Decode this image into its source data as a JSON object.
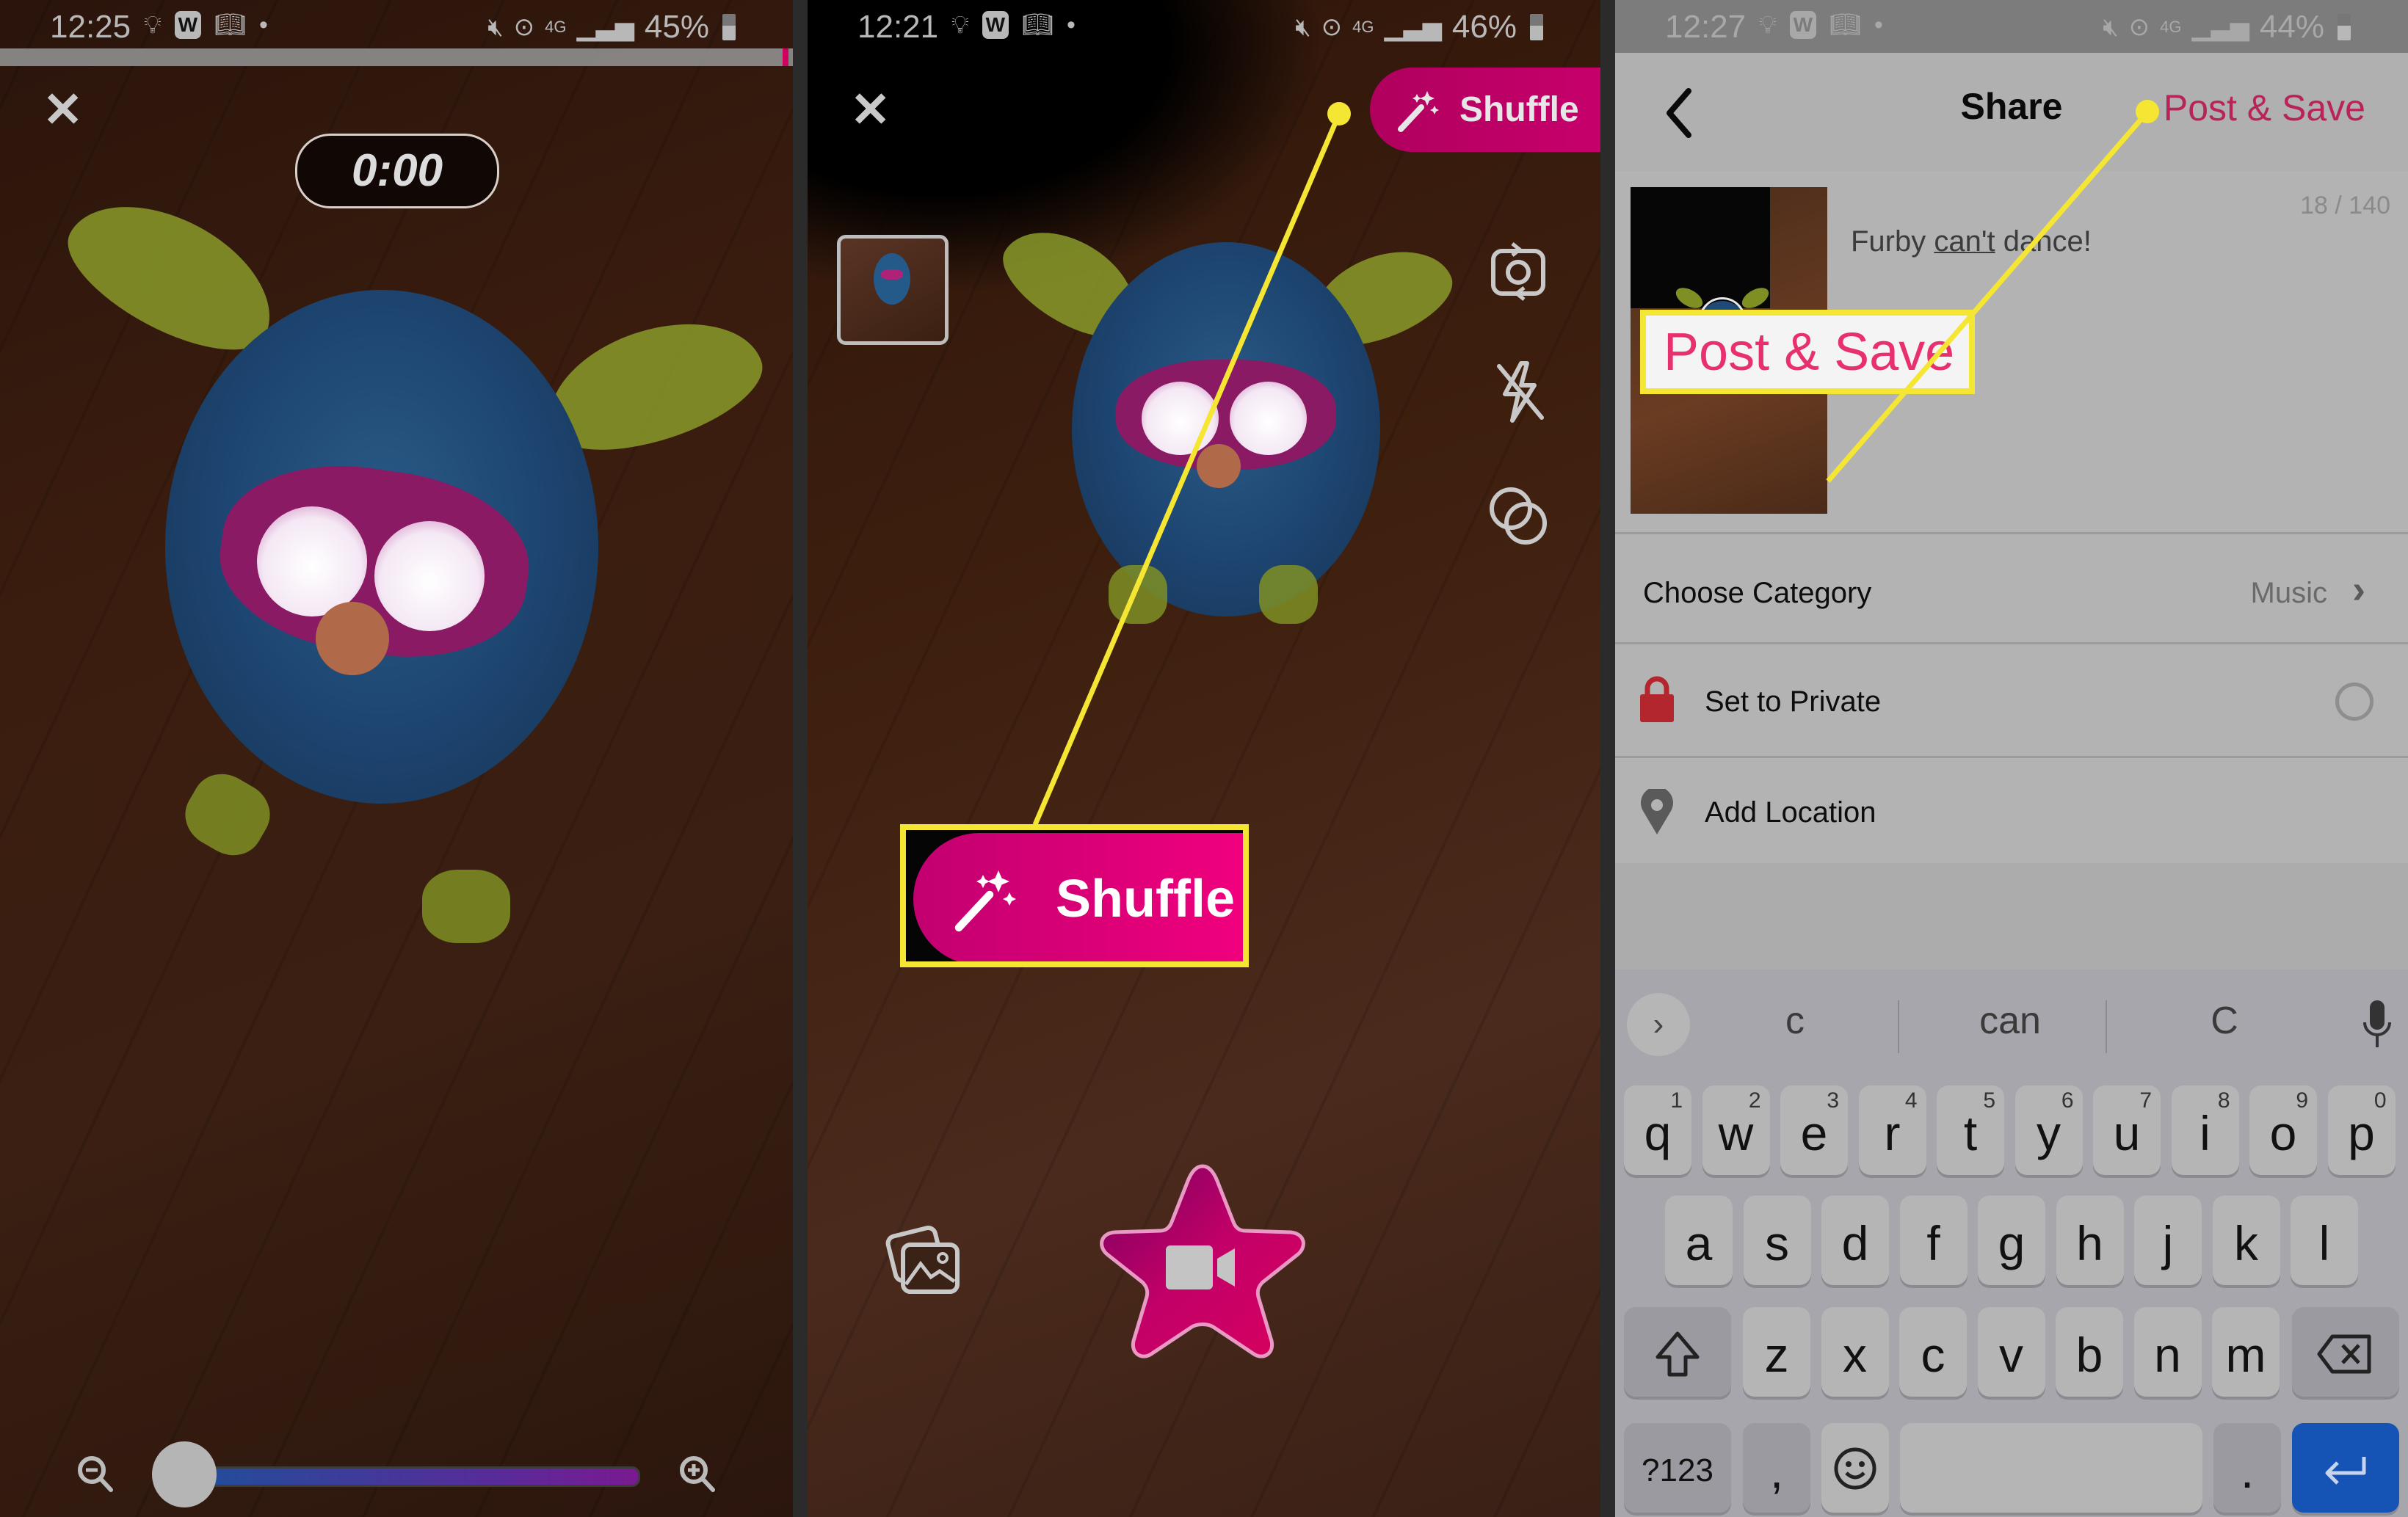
{
  "panels": {
    "recording": {
      "status_bar": {
        "time": "12:25",
        "battery": "45%",
        "network": "4G"
      },
      "close_icon": "close-icon",
      "timer": "0:00",
      "zoom_slider": {
        "value": 0.0,
        "min_icon": "zoom-out-icon",
        "max_icon": "zoom-in-icon"
      }
    },
    "camera": {
      "status_bar": {
        "time": "12:21",
        "battery": "46%",
        "network": "4G"
      },
      "shuffle_button": {
        "label": "Shuffle",
        "icon": "magic-wand-icon"
      },
      "callout_label": "Shuffle",
      "side_icons": [
        "switch-camera-icon",
        "flash-off-icon",
        "effects-icon"
      ],
      "gallery_icon": "gallery-icon",
      "record_icon": "video-camera-icon"
    },
    "share": {
      "status_bar": {
        "time": "12:27",
        "battery": "44%",
        "network": "4G"
      },
      "header": {
        "title": "Share",
        "action": "Post & Save"
      },
      "char_count": "18 / 140",
      "caption": {
        "before": "Furby ",
        "underlined": "can't",
        "after": " dance!"
      },
      "callout_label": "Post & Save",
      "rows": [
        {
          "label": "Choose Category",
          "value": "Music"
        },
        {
          "label": "Set to Private",
          "checked": false
        },
        {
          "label": "Add Location"
        }
      ],
      "keyboard": {
        "suggestions": [
          "c",
          "can",
          "C"
        ],
        "row1": [
          {
            "k": "q",
            "n": "1"
          },
          {
            "k": "w",
            "n": "2"
          },
          {
            "k": "e",
            "n": "3"
          },
          {
            "k": "r",
            "n": "4"
          },
          {
            "k": "t",
            "n": "5"
          },
          {
            "k": "y",
            "n": "6"
          },
          {
            "k": "u",
            "n": "7"
          },
          {
            "k": "i",
            "n": "8"
          },
          {
            "k": "o",
            "n": "9"
          },
          {
            "k": "p",
            "n": "0"
          }
        ],
        "row2": [
          "a",
          "s",
          "d",
          "f",
          "g",
          "h",
          "j",
          "k",
          "l"
        ],
        "row3": [
          "z",
          "x",
          "c",
          "v",
          "b",
          "n",
          "m"
        ],
        "symbols_key": "?123",
        "comma_key": ",",
        "period_key": "."
      }
    }
  },
  "colors": {
    "brand_pink": "#e8007a",
    "callout_yellow": "#f5e634",
    "post_save_text": "#b8245a",
    "lock_red": "#b3262e",
    "enter_blue": "#1553b4"
  }
}
